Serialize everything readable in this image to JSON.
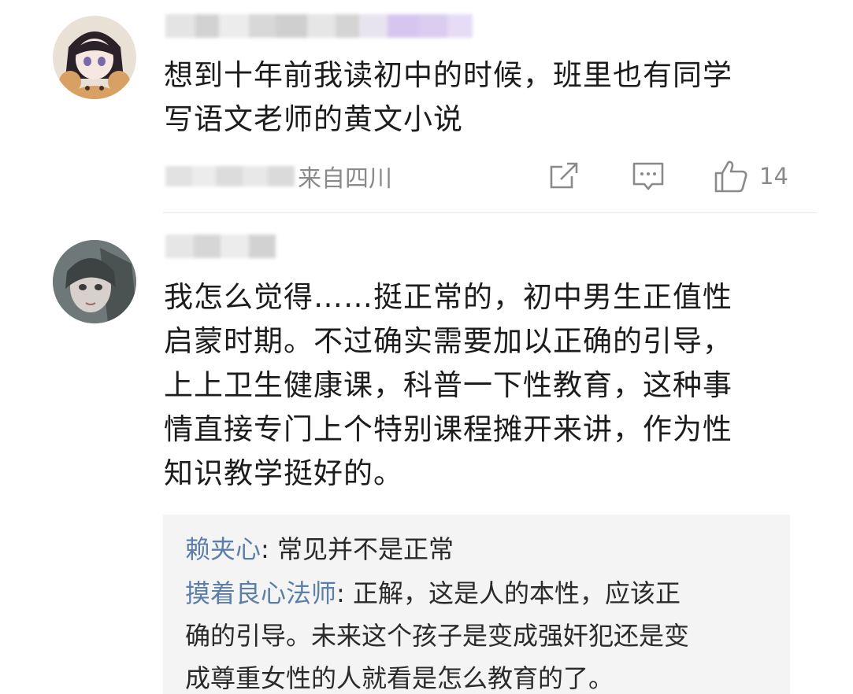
{
  "comments": [
    {
      "text_lines": [
        "想到十年前我读初中的时候，班里也有同学",
        "写语文老师的黄文小说"
      ],
      "location": "来自四川",
      "like_count": "14",
      "icons": [
        "share-icon",
        "comment-icon",
        "thumbs-up-icon"
      ]
    },
    {
      "text_lines": [
        "我怎么觉得……挺正常的，初中男生正值性",
        "启蒙时期。不过确实需要加以正确的引导，",
        "上上卫生健康课，科普一下性教育，这种事",
        "情直接专门上个特别课程摊开来讲，作为性",
        "知识教学挺好的。"
      ]
    }
  ],
  "replies": [
    {
      "author": "赖夹心",
      "lines": [
        "常见并不是正常"
      ]
    },
    {
      "author": "摸着良心法师",
      "lines": [
        "正解，这是人的本性，应该正",
        "确的引导。未来这个孩子是变成强奸犯还是变",
        "成尊重女性的人就看是怎么教育的了。"
      ]
    }
  ],
  "colors": {
    "reply_author": "#5b7fa8",
    "meta_text": "#8a8a8a",
    "reply_bg": "#f4f4f4"
  }
}
